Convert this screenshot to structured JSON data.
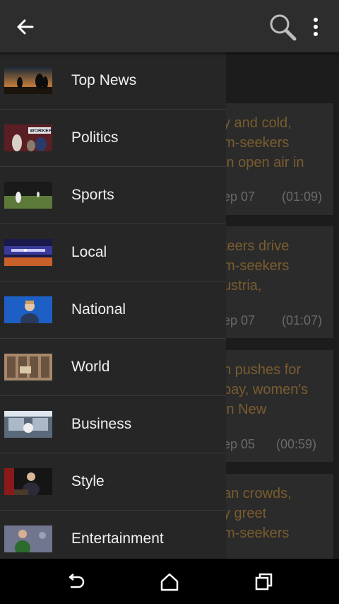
{
  "toolbar": {
    "back_icon": "arrow-back-icon",
    "search_icon": "search-icon",
    "more_icon": "more-vert-icon"
  },
  "drawer": {
    "items": [
      {
        "label": "Top News",
        "thumb": "sunset-people-thumbnail"
      },
      {
        "label": "Politics",
        "thumb": "workers-rally-thumbnail"
      },
      {
        "label": "Sports",
        "thumb": "baseball-field-thumbnail"
      },
      {
        "label": "Local",
        "thumb": "city-stage-thumbnail"
      },
      {
        "label": "National",
        "thumb": "speaker-blue-background-thumbnail"
      },
      {
        "label": "World",
        "thumb": "building-facade-thumbnail"
      },
      {
        "label": "Business",
        "thumb": "office-interior-thumbnail"
      },
      {
        "label": "Style",
        "thumb": "seated-speaker-thumbnail"
      },
      {
        "label": "Entertainment",
        "thumb": "red-carpet-thumbnail"
      }
    ]
  },
  "stories": [
    {
      "headline": "y and cold,\nm-seekers\n in open air in",
      "date": "ep 07",
      "duration": "(01:09)"
    },
    {
      "headline": "teers drive\nm-seekers\nustria,",
      "date": "ep 07",
      "duration": "(01:07)"
    },
    {
      "headline": "n pushes for\n pay, women's\n in New",
      "date": "ep 05",
      "duration": "(00:59)"
    },
    {
      "headline": "an crowds,\ny greet\nm-seekers",
      "date": "",
      "duration": ""
    }
  ],
  "navbar": {
    "back_icon": "nav-back-icon",
    "home_icon": "home-icon",
    "recents_icon": "recent-apps-icon"
  }
}
